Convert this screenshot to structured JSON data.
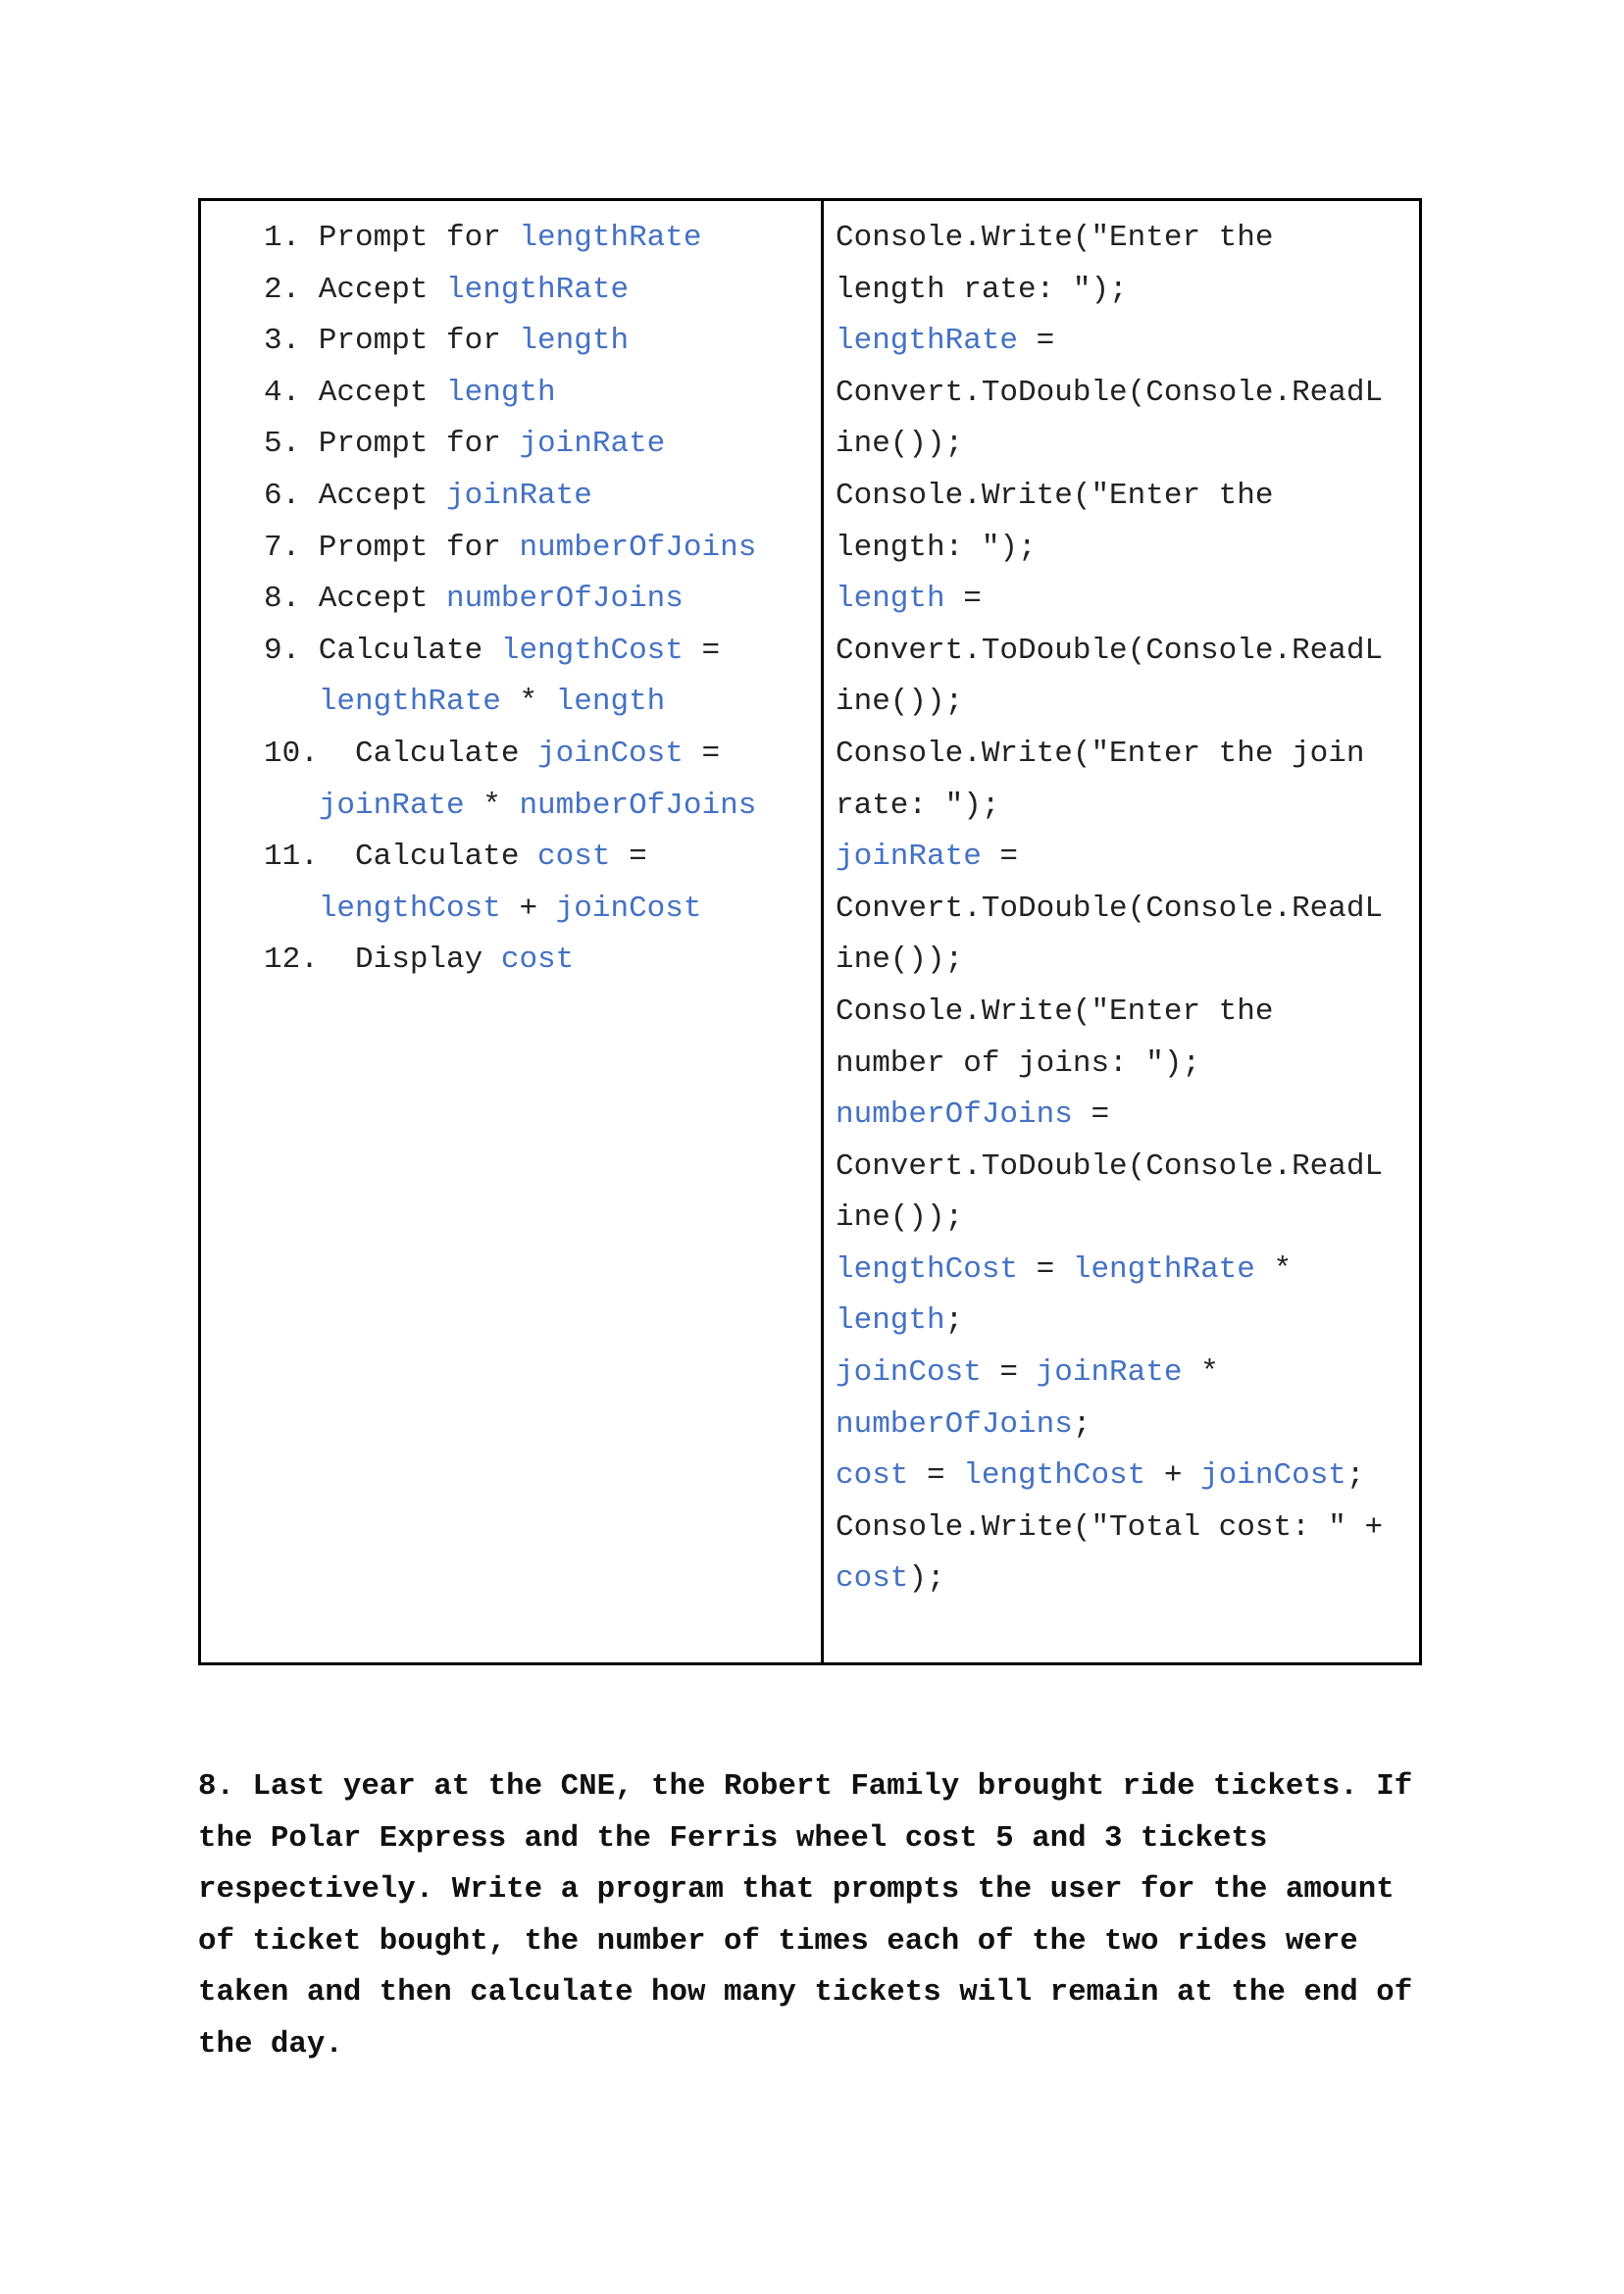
{
  "pseudocode": [
    [
      [
        "1. Prompt for ",
        0
      ],
      [
        "lengthRate",
        1
      ]
    ],
    [
      [
        "2. Accept ",
        0
      ],
      [
        "lengthRate",
        1
      ]
    ],
    [
      [
        "3. Prompt for ",
        0
      ],
      [
        "length",
        1
      ]
    ],
    [
      [
        "4. Accept ",
        0
      ],
      [
        "length",
        1
      ]
    ],
    [
      [
        "5. Prompt for ",
        0
      ],
      [
        "joinRate",
        1
      ]
    ],
    [
      [
        "6. Accept ",
        0
      ],
      [
        "joinRate",
        1
      ]
    ],
    [
      [
        "7. Prompt for ",
        0
      ],
      [
        "numberOfJoins",
        1
      ]
    ],
    [
      [
        "8. Accept ",
        0
      ],
      [
        "numberOfJoins",
        1
      ]
    ],
    [
      [
        "9. Calculate ",
        0
      ],
      [
        "lengthCost",
        1
      ],
      [
        " =",
        0
      ]
    ],
    [
      [
        "   ",
        0
      ],
      [
        "lengthRate",
        1
      ],
      [
        " * ",
        0
      ],
      [
        "length",
        1
      ]
    ],
    [
      [
        "10.  Calculate ",
        0
      ],
      [
        "joinCost",
        1
      ],
      [
        " =",
        0
      ]
    ],
    [
      [
        "   ",
        0
      ],
      [
        "joinRate",
        1
      ],
      [
        " * ",
        0
      ],
      [
        "numberOfJoins",
        1
      ]
    ],
    [
      [
        "11.  Calculate ",
        0
      ],
      [
        "cost",
        1
      ],
      [
        " =",
        0
      ]
    ],
    [
      [
        "   ",
        0
      ],
      [
        "lengthCost",
        1
      ],
      [
        " + ",
        0
      ],
      [
        "joinCost",
        1
      ]
    ],
    [
      [
        "12.  Display ",
        0
      ],
      [
        "cost",
        1
      ]
    ]
  ],
  "code": [
    [
      [
        "Console.Write(\"Enter the",
        0
      ]
    ],
    [
      [
        "length rate: \");",
        0
      ]
    ],
    [
      [
        "lengthRate",
        1
      ],
      [
        " =",
        0
      ]
    ],
    [
      [
        "Convert.ToDouble(Console.ReadL",
        0
      ]
    ],
    [
      [
        "ine());",
        0
      ]
    ],
    [
      [
        "Console.Write(\"Enter the",
        0
      ]
    ],
    [
      [
        "length: \");",
        0
      ]
    ],
    [
      [
        "length",
        1
      ],
      [
        " =",
        0
      ]
    ],
    [
      [
        "Convert.ToDouble(Console.ReadL",
        0
      ]
    ],
    [
      [
        "ine());",
        0
      ]
    ],
    [
      [
        "Console.Write(\"Enter the join",
        0
      ]
    ],
    [
      [
        "rate: \");",
        0
      ]
    ],
    [
      [
        "joinRate",
        1
      ],
      [
        " =",
        0
      ]
    ],
    [
      [
        "Convert.ToDouble(Console.ReadL",
        0
      ]
    ],
    [
      [
        "ine());",
        0
      ]
    ],
    [
      [
        "Console.Write(\"Enter the",
        0
      ]
    ],
    [
      [
        "number of joins: \");",
        0
      ]
    ],
    [
      [
        "numberOfJoins",
        1
      ],
      [
        " =",
        0
      ]
    ],
    [
      [
        "Convert.ToDouble(Console.ReadL",
        0
      ]
    ],
    [
      [
        "ine());",
        0
      ]
    ],
    [
      [
        "lengthCost",
        1
      ],
      [
        " = ",
        0
      ],
      [
        "lengthRate",
        1
      ],
      [
        " *",
        0
      ]
    ],
    [
      [
        "length",
        1
      ],
      [
        ";",
        0
      ]
    ],
    [
      [
        "joinCost",
        1
      ],
      [
        " = ",
        0
      ],
      [
        "joinRate",
        1
      ],
      [
        " *",
        0
      ]
    ],
    [
      [
        "numberOfJoins",
        1
      ],
      [
        ";",
        0
      ]
    ],
    [
      [
        "cost",
        1
      ],
      [
        " = ",
        0
      ],
      [
        "lengthCost",
        1
      ],
      [
        " + ",
        0
      ],
      [
        "joinCost",
        1
      ],
      [
        ";",
        0
      ]
    ],
    [
      [
        "Console.Write(\"Total cost: \" +",
        0
      ]
    ],
    [
      [
        "cost",
        1
      ],
      [
        ");",
        0
      ]
    ]
  ],
  "question": {
    "lines": [
      "8. Last year at the CNE, the Robert Family brought ride tickets. If",
      "the Polar Express and the Ferris wheel cost 5 and 3 tickets",
      "respectively. Write a program that prompts the user for the amount",
      "of ticket bought, the number of times each of the two rides were",
      "taken and then calculate how many tickets will remain at the end of",
      "the day."
    ]
  },
  "colors": {
    "variable": "#4472c4",
    "text": "#222222"
  }
}
